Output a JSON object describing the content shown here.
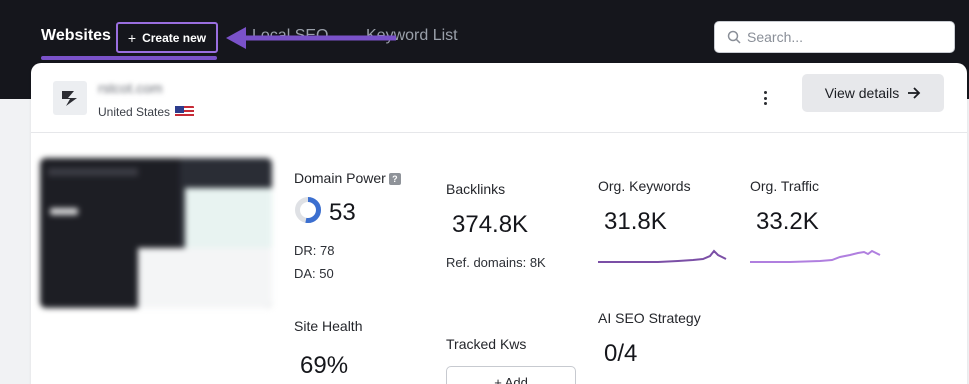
{
  "nav": {
    "tabs": [
      {
        "label": "Websites"
      },
      {
        "label": "Local SEO"
      },
      {
        "label": "Keyword List"
      }
    ],
    "create_label": "Create new",
    "create_plus": "+"
  },
  "search": {
    "placeholder": "Search..."
  },
  "site": {
    "name": "rstcot.com",
    "country": "United States"
  },
  "view_details_label": "View details",
  "metrics": {
    "domain_power": {
      "label": "Domain Power",
      "help": "?",
      "value": "53",
      "ring_fraction": 0.53
    },
    "dr": "DR: 78",
    "da": "DA: 50",
    "backlinks": {
      "label": "Backlinks",
      "value": "374.8K"
    },
    "ref_domains": "Ref. domains: 8K",
    "org_keywords": {
      "label": "Org. Keywords",
      "value": "31.8K"
    },
    "org_traffic": {
      "label": "Org. Traffic",
      "value": "33.2K"
    },
    "site_health": {
      "label": "Site Health",
      "value": "69%"
    },
    "tracked_kws": {
      "label": "Tracked Kws",
      "add_label": "+ Add"
    },
    "ai_seo": {
      "label": "AI SEO Strategy",
      "value": "0/4"
    }
  },
  "colors": {
    "accent": "#7a52c9",
    "ring": "#3b6fd0",
    "keywords_line": "#7b4fa6",
    "traffic_line": "#b07fdf"
  }
}
